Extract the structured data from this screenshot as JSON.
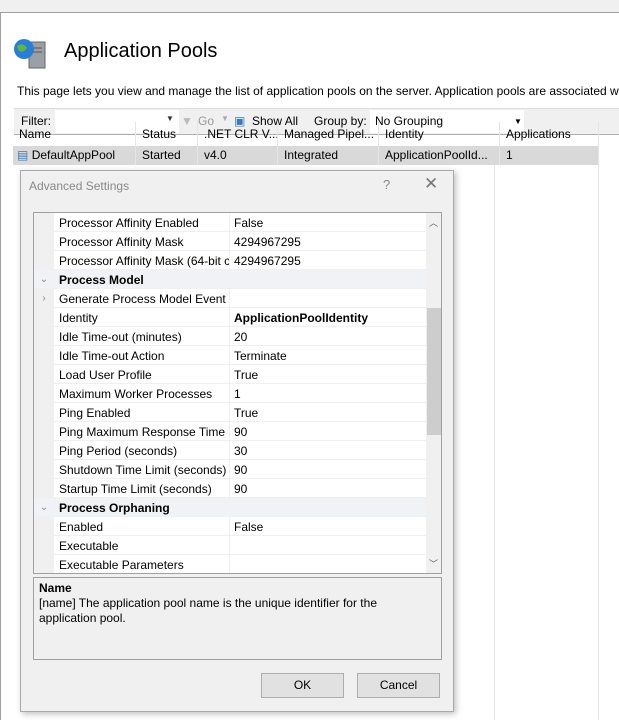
{
  "page": {
    "title": "Application Pools",
    "description": "This page lets you view and manage the list of application pools on the server. Application pools are associated wit"
  },
  "toolbar": {
    "filter_label": "Filter:",
    "filter_value": "",
    "go_label": "Go",
    "show_all_label": "Show All",
    "group_by_label": "Group by:",
    "group_by_value": "No Grouping"
  },
  "table": {
    "columns": [
      "Name",
      "Status",
      ".NET CLR V...",
      "Managed Pipel...",
      "Identity",
      "Applications"
    ],
    "rows": [
      [
        "DefaultAppPool",
        "Started",
        "v4.0",
        "Integrated",
        "ApplicationPoolId...",
        "1"
      ]
    ]
  },
  "dialog": {
    "title": "Advanced Settings",
    "help": "?",
    "close": "✕",
    "properties": [
      {
        "name": "Processor Affinity Enabled",
        "value": "False"
      },
      {
        "name": "Processor Affinity Mask",
        "value": "4294967295"
      },
      {
        "name": "Processor Affinity Mask (64-bit c",
        "value": "4294967295"
      },
      {
        "name": "Process Model",
        "category": true
      },
      {
        "name": "Generate Process Model Event L",
        "value": "",
        "expandable": true
      },
      {
        "name": "Identity",
        "value": "ApplicationPoolIdentity",
        "bold": true
      },
      {
        "name": "Idle Time-out (minutes)",
        "value": "20"
      },
      {
        "name": "Idle Time-out Action",
        "value": "Terminate"
      },
      {
        "name": "Load User Profile",
        "value": "True"
      },
      {
        "name": "Maximum Worker Processes",
        "value": "1"
      },
      {
        "name": "Ping Enabled",
        "value": "True"
      },
      {
        "name": "Ping Maximum Response Time (",
        "value": "90"
      },
      {
        "name": "Ping Period (seconds)",
        "value": "30"
      },
      {
        "name": "Shutdown Time Limit (seconds)",
        "value": "90"
      },
      {
        "name": "Startup Time Limit (seconds)",
        "value": "90"
      },
      {
        "name": "Process Orphaning",
        "category": true
      },
      {
        "name": "Enabled",
        "value": "False"
      },
      {
        "name": "Executable",
        "value": ""
      },
      {
        "name": "Executable Parameters",
        "value": ""
      }
    ],
    "description_title": "Name",
    "description_text": "[name] The application pool name is the unique identifier for the application pool.",
    "ok_label": "OK",
    "cancel_label": "Cancel"
  }
}
